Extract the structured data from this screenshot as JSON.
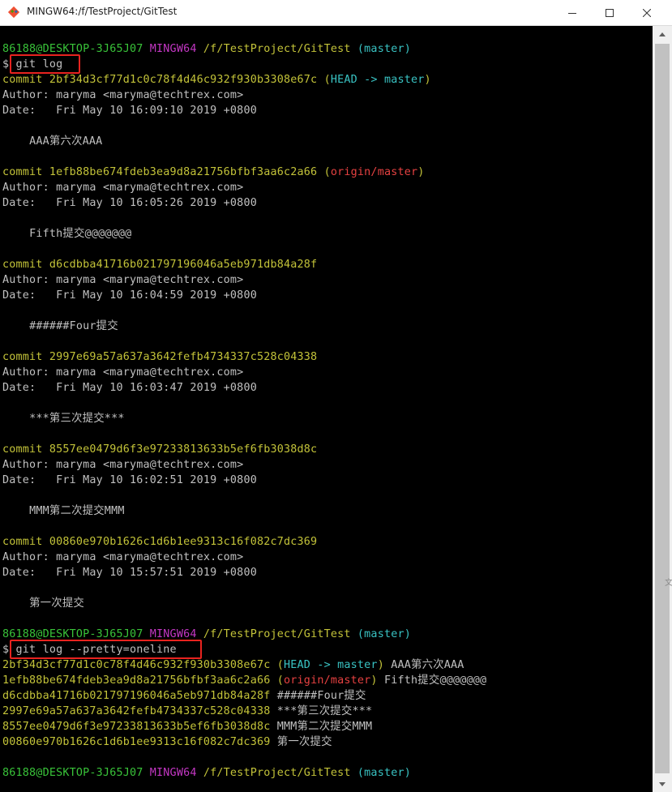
{
  "window": {
    "title": "MINGW64:/f/TestProject/GitTest"
  },
  "prompt": {
    "user_host": "86188@DESKTOP-3J65J07",
    "env": "MINGW64",
    "path": "/f/TestProject/GitTest",
    "branch": "(master)",
    "symbol": "$"
  },
  "commands": {
    "git_log": "git log",
    "git_log_oneline": "git log --pretty=oneline"
  },
  "labels": {
    "commit": "commit",
    "author": "Author:",
    "date": "Date:"
  },
  "commits": [
    {
      "hash": "2bf34d3cf77d1c0c78f4d46c932f930b3308e67c",
      "refs_open": "(",
      "head_ref": "HEAD -> master",
      "refs_close": ")",
      "author": "maryma <maryma@techtrex.com>",
      "date": "Fri May 10 16:09:10 2019 +0800",
      "message": "AAA第六次AAA"
    },
    {
      "hash": "1efb88be674fdeb3ea9d8a21756bfbf3aa6c2a66",
      "refs_open": "(",
      "origin_ref": "origin/master",
      "refs_close": ")",
      "author": "maryma <maryma@techtrex.com>",
      "date": "Fri May 10 16:05:26 2019 +0800",
      "message": "Fifth提交@@@@@@@"
    },
    {
      "hash": "d6cdbba41716b021797196046a5eb971db84a28f",
      "author": "maryma <maryma@techtrex.com>",
      "date": "Fri May 10 16:04:59 2019 +0800",
      "message": "######Four提交"
    },
    {
      "hash": "2997e69a57a637a3642fefb4734337c528c04338",
      "author": "maryma <maryma@techtrex.com>",
      "date": "Fri May 10 16:03:47 2019 +0800",
      "message": "***第三次提交***"
    },
    {
      "hash": "8557ee0479d6f3e97233813633b5ef6fb3038d8c",
      "author": "maryma <maryma@techtrex.com>",
      "date": "Fri May 10 16:02:51 2019 +0800",
      "message": "MMM第二次提交MMM"
    },
    {
      "hash": "00860e970b1626c1d6b1ee9313c16f082c7dc369",
      "author": "maryma <maryma@techtrex.com>",
      "date": "Fri May 10 15:57:51 2019 +0800",
      "message": "第一次提交"
    }
  ],
  "side_text": "文",
  "colors": {
    "green": "#39c339",
    "magenta": "#c337c3",
    "yellow": "#c3c339",
    "cyan": "#39c3c3",
    "red": "#e64141",
    "text": "#c0c0c0",
    "highlight_box": "#e8231f"
  }
}
